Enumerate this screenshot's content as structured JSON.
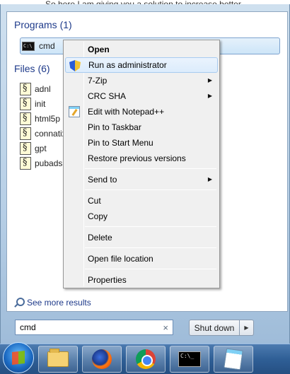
{
  "background": {
    "partial_text": "So here I am giving you a solution to increase better"
  },
  "start_menu": {
    "programs_header": "Programs (1)",
    "programs": [
      {
        "label": "cmd",
        "icon": "cmd-icon"
      }
    ],
    "files_header": "Files (6)",
    "files": [
      {
        "label": "adnl"
      },
      {
        "label": "init"
      },
      {
        "label": "html5p"
      },
      {
        "label": "connatix"
      },
      {
        "label": "gpt"
      },
      {
        "label": "pubads"
      }
    ],
    "see_more": "See more results",
    "search": {
      "value": "cmd",
      "clear_icon": "×"
    },
    "shutdown": {
      "label": "Shut down",
      "arrow": "▶"
    }
  },
  "context_menu": {
    "items": [
      {
        "label": "Open",
        "bold": true
      },
      {
        "label": "Run as administrator",
        "icon": "shield-icon",
        "highlight": true
      },
      {
        "label": "7-Zip",
        "submenu": true
      },
      {
        "label": "CRC SHA",
        "submenu": true
      },
      {
        "label": "Edit with Notepad++",
        "icon": "notepad-icon"
      },
      {
        "label": "Pin to Taskbar"
      },
      {
        "label": "Pin to Start Menu"
      },
      {
        "label": "Restore previous versions"
      },
      {
        "separator": true
      },
      {
        "label": "Send to",
        "submenu": true
      },
      {
        "separator": true
      },
      {
        "label": "Cut"
      },
      {
        "label": "Copy"
      },
      {
        "separator": true
      },
      {
        "label": "Delete"
      },
      {
        "separator": true
      },
      {
        "label": "Open file location"
      },
      {
        "separator": true
      },
      {
        "label": "Properties"
      }
    ]
  },
  "taskbar": {
    "items": [
      {
        "name": "start-orb"
      },
      {
        "name": "explorer",
        "icon": "folder-icon"
      },
      {
        "name": "firefox",
        "icon": "firefox-icon"
      },
      {
        "name": "chrome",
        "icon": "chrome-icon"
      },
      {
        "name": "cmd",
        "icon": "console-icon"
      },
      {
        "name": "notepad",
        "icon": "notepad-icon"
      }
    ]
  },
  "colors": {
    "accent": "#1e3a8a",
    "highlight": "#dcecfc",
    "taskbar": "#2f5f96"
  }
}
